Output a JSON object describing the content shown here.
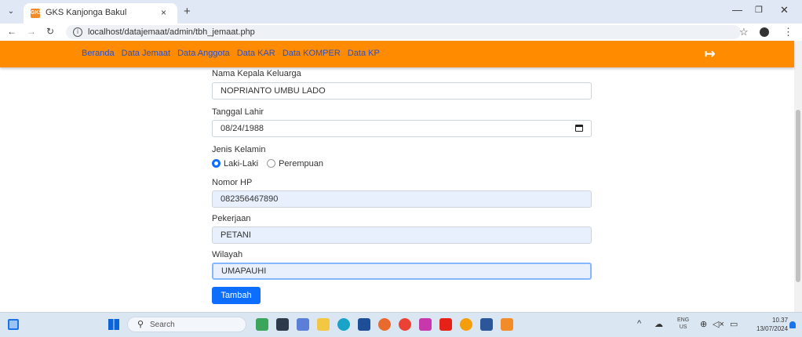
{
  "browser": {
    "tab_title": "GKS Kanjonga Bakul",
    "tab_favicon": "GKS",
    "tab_close": "×",
    "new_tab": "+",
    "url": "localhost/datajemaat/admin/tbh_jemaat.php"
  },
  "navbar": {
    "links": [
      "Beranda",
      "Data Jemaat",
      "Data Anggota",
      "Data KAR",
      "Data KOMPER",
      "Data KP"
    ],
    "logout_icon": "logout-icon",
    "bg_color": "#ff8c00",
    "link_color": "#2b50c7"
  },
  "form": {
    "kepala_label": "Nama Kepala Keluarga",
    "kepala_value": "NOPRIANTO UMBU LADO",
    "tanggal_label": "Tanggal Lahir",
    "tanggal_value": "08/24/1988",
    "jk_label": "Jenis Kelamin",
    "jk_option_laki": "Laki-Laki",
    "jk_option_perempuan": "Perempuan",
    "jk_selected": "Laki-Laki",
    "hp_label": "Nomor HP",
    "hp_value": "082356467890",
    "pekerjaan_label": "Pekerjaan",
    "pekerjaan_value": "PETANI",
    "wilayah_label": "Wilayah",
    "wilayah_value": "UMAPAUHI",
    "submit_label": "Tambah",
    "submit_color": "#0d6efd"
  },
  "taskbar": {
    "search_placeholder": "Search",
    "lang_line1": "ENG",
    "lang_line2": "US",
    "time": "10.37",
    "date": "13/07/2024"
  }
}
